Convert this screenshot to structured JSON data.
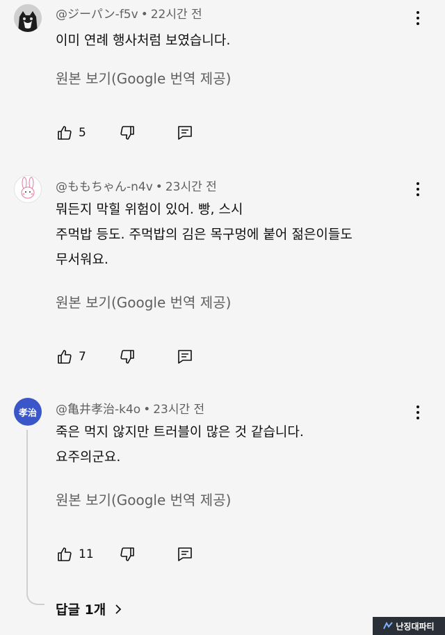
{
  "comments": [
    {
      "author": "@ジーパン-f5v",
      "separator": "•",
      "time": "22시간 전",
      "lines": [
        "이미 연례 행사처럼 보였습니다."
      ],
      "translate": "원본 보기(Google 번역 제공)",
      "likes": "5"
    },
    {
      "author": "@ももちゃん-n4v",
      "separator": "•",
      "time": "23시간 전",
      "lines": [
        "뭐든지 막힐 위험이 있어. 빵, 스시",
        "주먹밥 등도. 주먹밥의 김은 목구멍에 붙어 젊은이들도",
        "무서워요."
      ],
      "translate": "원본 보기(Google 번역 제공)",
      "likes": "7"
    },
    {
      "author": "@亀井孝治-k4o",
      "separator": "•",
      "time": "23시간 전",
      "avatar_text": "孝治",
      "lines": [
        "죽은 먹지 않지만 트러블이 많은 것 같습니다.",
        "요주의군요."
      ],
      "translate": "원본 보기(Google 번역 제공)",
      "likes": "11",
      "replies": "답글 1개"
    }
  ],
  "watermark": "난징대파티",
  "colors": {
    "background": "#f5f5f5",
    "secondary_text": "#606060",
    "avatar3": "#3a56c8"
  },
  "icons": [
    "like-icon",
    "dislike-icon",
    "reply-icon",
    "more-icon",
    "chevron-right-icon"
  ]
}
